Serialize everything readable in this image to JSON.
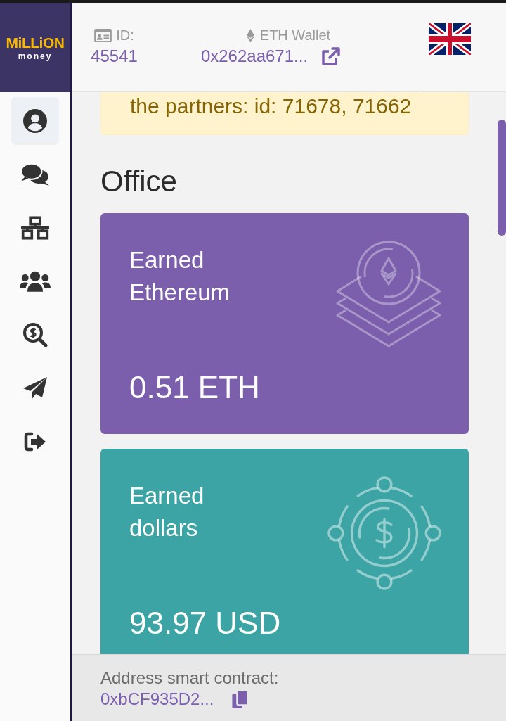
{
  "logo": {
    "title": "MiLLiON",
    "subtitle": "money"
  },
  "sidebar": {
    "items": [
      {
        "selected": true
      },
      {
        "selected": false
      },
      {
        "selected": false
      },
      {
        "selected": false
      },
      {
        "selected": false
      },
      {
        "selected": false
      },
      {
        "selected": false
      }
    ]
  },
  "header": {
    "id": {
      "label": "ID:",
      "value": "45541"
    },
    "wallet": {
      "label": "ETH Wallet",
      "value": "0x262aa671..."
    }
  },
  "alert": {
    "text": "the partners: id: 71678, 71662"
  },
  "section": {
    "title": "Office"
  },
  "cards": [
    {
      "kind": "eth",
      "color": "#7b5fad",
      "label": "Earned Ethereum",
      "value": "0.51 ETH"
    },
    {
      "kind": "usd",
      "color": "#3ca4a4",
      "label": "Earned dollars",
      "value": "93.97 USD"
    }
  ],
  "footer": {
    "label": "Address smart contract:",
    "value": "0xbCF935D2..."
  }
}
